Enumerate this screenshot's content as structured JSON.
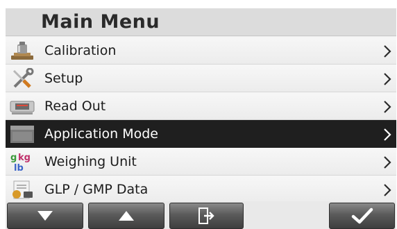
{
  "title": "Main Menu",
  "menu": {
    "items": [
      {
        "label": "Calibration",
        "icon": "scale-weight-icon",
        "selected": false
      },
      {
        "label": "Setup",
        "icon": "tools-icon",
        "selected": false
      },
      {
        "label": "Read Out",
        "icon": "display-readout-icon",
        "selected": false
      },
      {
        "label": "Application Mode",
        "icon": "application-mode-icon",
        "selected": true
      },
      {
        "label": "Weighing Unit",
        "icon": "units-g-kg-lb-icon",
        "selected": false
      },
      {
        "label": "GLP / GMP Data",
        "icon": "glp-data-icon",
        "selected": false
      }
    ]
  },
  "softkeys": [
    "arrow-down-icon",
    "arrow-up-icon",
    "exit-icon",
    "check-icon"
  ],
  "colors": {
    "selected_bg": "#1f1f1f",
    "unit_g": "#3a9a3a",
    "unit_kg": "#c0306a",
    "unit_lb": "#3a63c8"
  }
}
